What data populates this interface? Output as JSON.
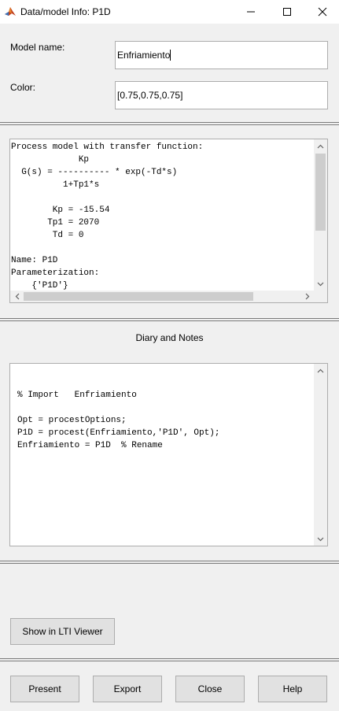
{
  "window": {
    "title": "Data/model Info: P1D",
    "minimize_glyph": "—",
    "maximize_glyph": "☐",
    "close_glyph": "✕"
  },
  "model": {
    "name_label": "Model name:",
    "name_value": "Enfriamiento",
    "color_label": "Color:",
    "color_value": "[0.75,0.75,0.75]"
  },
  "info_pane": {
    "lines": [
      "Process model with transfer function:",
      "             Kp",
      "  G(s) = ---------- * exp(-Td*s)",
      "          1+Tp1*s",
      "",
      "        Kp = -15.54",
      "       Tp1 = 2070",
      "        Td = 0",
      "",
      "Name: P1D",
      "Parameterization:",
      "    {'P1D'}"
    ]
  },
  "notes": {
    "heading": "Diary and Notes",
    "lines": [
      "",
      "",
      "% Import   Enfriamiento",
      "",
      "Opt = procestOptions;",
      "P1D = procest(Enfriamiento,'P1D', Opt);",
      "Enfriamiento = P1D  % Rename"
    ]
  },
  "buttons": {
    "lti_viewer": "Show in LTI Viewer",
    "present": "Present",
    "export": "Export",
    "close": "Close",
    "help": "Help"
  }
}
